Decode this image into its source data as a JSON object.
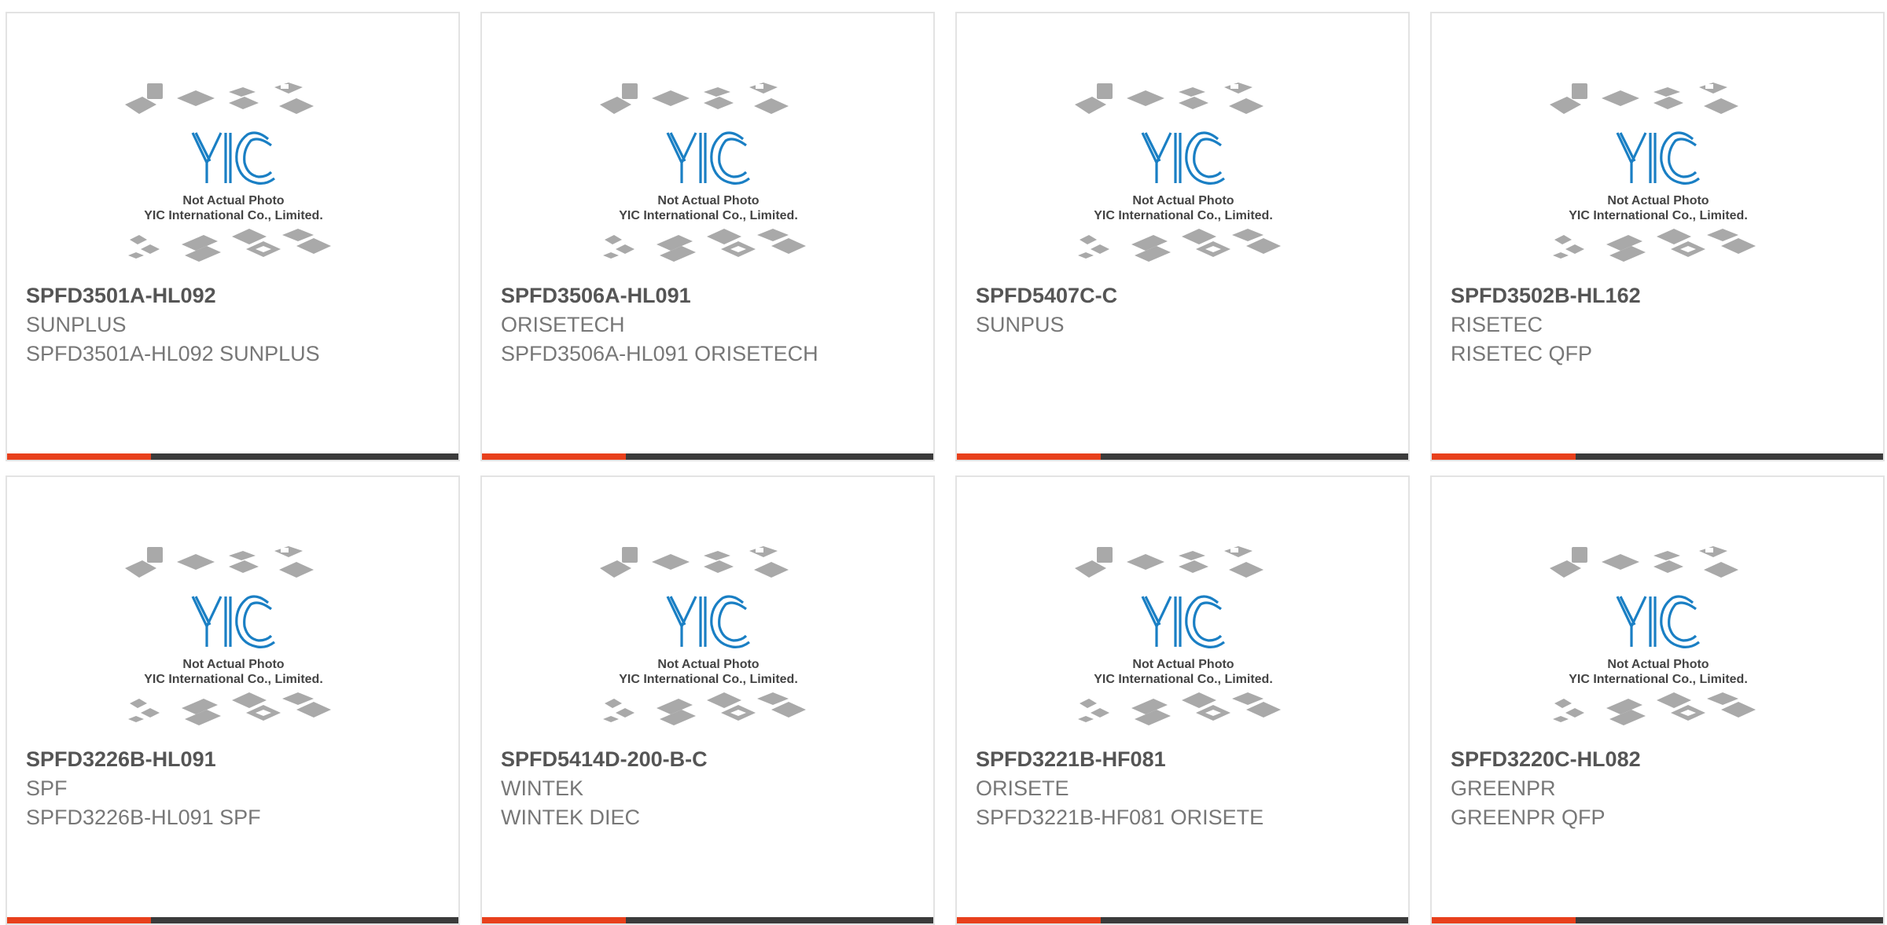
{
  "colors": {
    "accent": "#e8401c",
    "bar": "#3b3b3b",
    "logo": "#1a7fc4"
  },
  "placeholder": {
    "logo_text": "YIC",
    "caption_line1": "Not Actual Photo",
    "caption_line2": "YIC International Co., Limited."
  },
  "products": [
    {
      "part_number": "SPFD3501A-HL092",
      "manufacturer": "SUNPLUS",
      "description": "SPFD3501A-HL092 SUNPLUS"
    },
    {
      "part_number": "SPFD3506A-HL091",
      "manufacturer": "ORISETECH",
      "description": "SPFD3506A-HL091 ORISETECH"
    },
    {
      "part_number": "SPFD5407C-C",
      "manufacturer": "SUNPUS",
      "description": ""
    },
    {
      "part_number": "SPFD3502B-HL162",
      "manufacturer": "RISETEC",
      "description": "RISETEC QFP"
    },
    {
      "part_number": "SPFD3226B-HL091",
      "manufacturer": "SPF",
      "description": "SPFD3226B-HL091 SPF"
    },
    {
      "part_number": "SPFD5414D-200-B-C",
      "manufacturer": "WINTEK",
      "description": "WINTEK DIEC"
    },
    {
      "part_number": "SPFD3221B-HF081",
      "manufacturer": "ORISETE",
      "description": "SPFD3221B-HF081 ORISETE"
    },
    {
      "part_number": "SPFD3220C-HL082",
      "manufacturer": "GREENPR",
      "description": "GREENPR QFP"
    }
  ]
}
